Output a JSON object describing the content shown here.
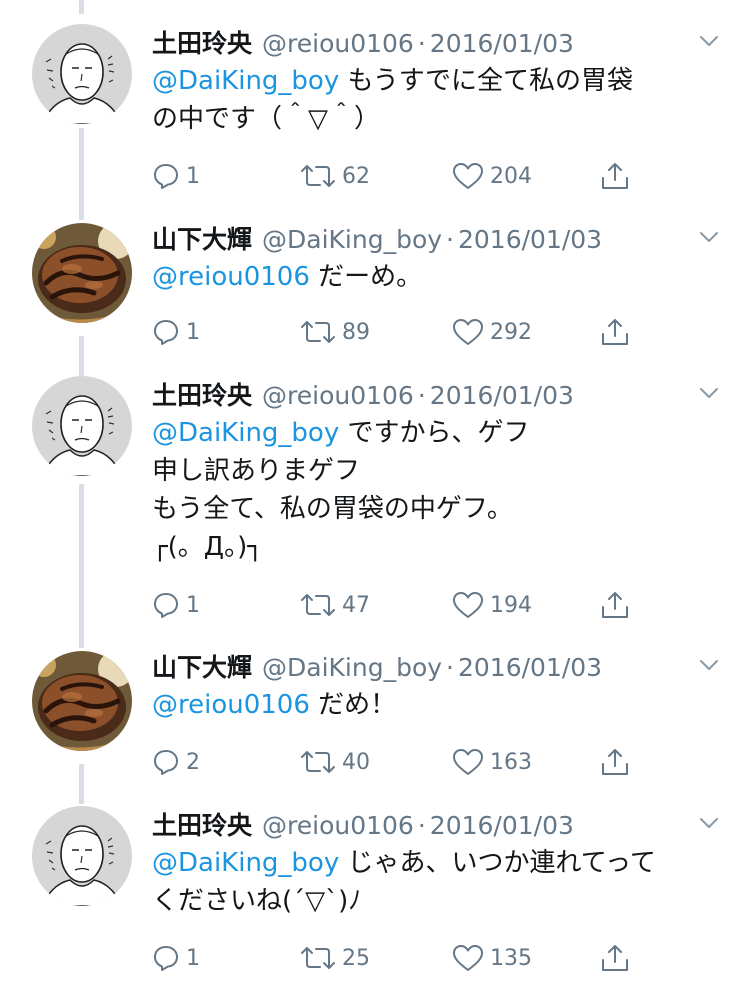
{
  "colors": {
    "mention": "#1b95e0",
    "muted": "#657786",
    "text": "#14171a",
    "thread_line": "#d8dee4"
  },
  "tweets": [
    {
      "name": "土田玲央",
      "handle": "@reiou0106",
      "separator": "·",
      "date": "2016/01/03",
      "avatar": "sketch-face-avatar",
      "mention": "@DaiKing_boy",
      "lines": [
        "もうすでに全て私の胃袋",
        "の中です（＾▽＾）"
      ],
      "reply_count": "1",
      "retweet_count": "62",
      "like_count": "204"
    },
    {
      "name": "山下大輝",
      "handle": "@DaiKing_boy",
      "separator": "·",
      "date": "2016/01/03",
      "avatar": "hamburg-steak-avatar",
      "mention": "@reiou0106",
      "lines": [
        "だーめ。"
      ],
      "reply_count": "1",
      "retweet_count": "89",
      "like_count": "292"
    },
    {
      "name": "土田玲央",
      "handle": "@reiou0106",
      "separator": "·",
      "date": "2016/01/03",
      "avatar": "sketch-face-avatar",
      "mention": "@DaiKing_boy",
      "lines": [
        "ですから、ゲフ",
        "申し訳ありまゲフ",
        "もう全て、私の胃袋の中ゲフ。",
        "┌(。Д。)┐"
      ],
      "reply_count": "1",
      "retweet_count": "47",
      "like_count": "194"
    },
    {
      "name": "山下大輝",
      "handle": "@DaiKing_boy",
      "separator": "·",
      "date": "2016/01/03",
      "avatar": "hamburg-steak-avatar",
      "mention": "@reiou0106",
      "lines": [
        "だめ！"
      ],
      "reply_count": "2",
      "retweet_count": "40",
      "like_count": "163"
    },
    {
      "name": "土田玲央",
      "handle": "@reiou0106",
      "separator": "·",
      "date": "2016/01/03",
      "avatar": "sketch-face-avatar",
      "mention": "@DaiKing_boy",
      "lines": [
        "じゃあ、いつか連れてって",
        "くださいね(´▽`)ﾉ"
      ],
      "reply_count": "1",
      "retweet_count": "25",
      "like_count": "135"
    }
  ]
}
